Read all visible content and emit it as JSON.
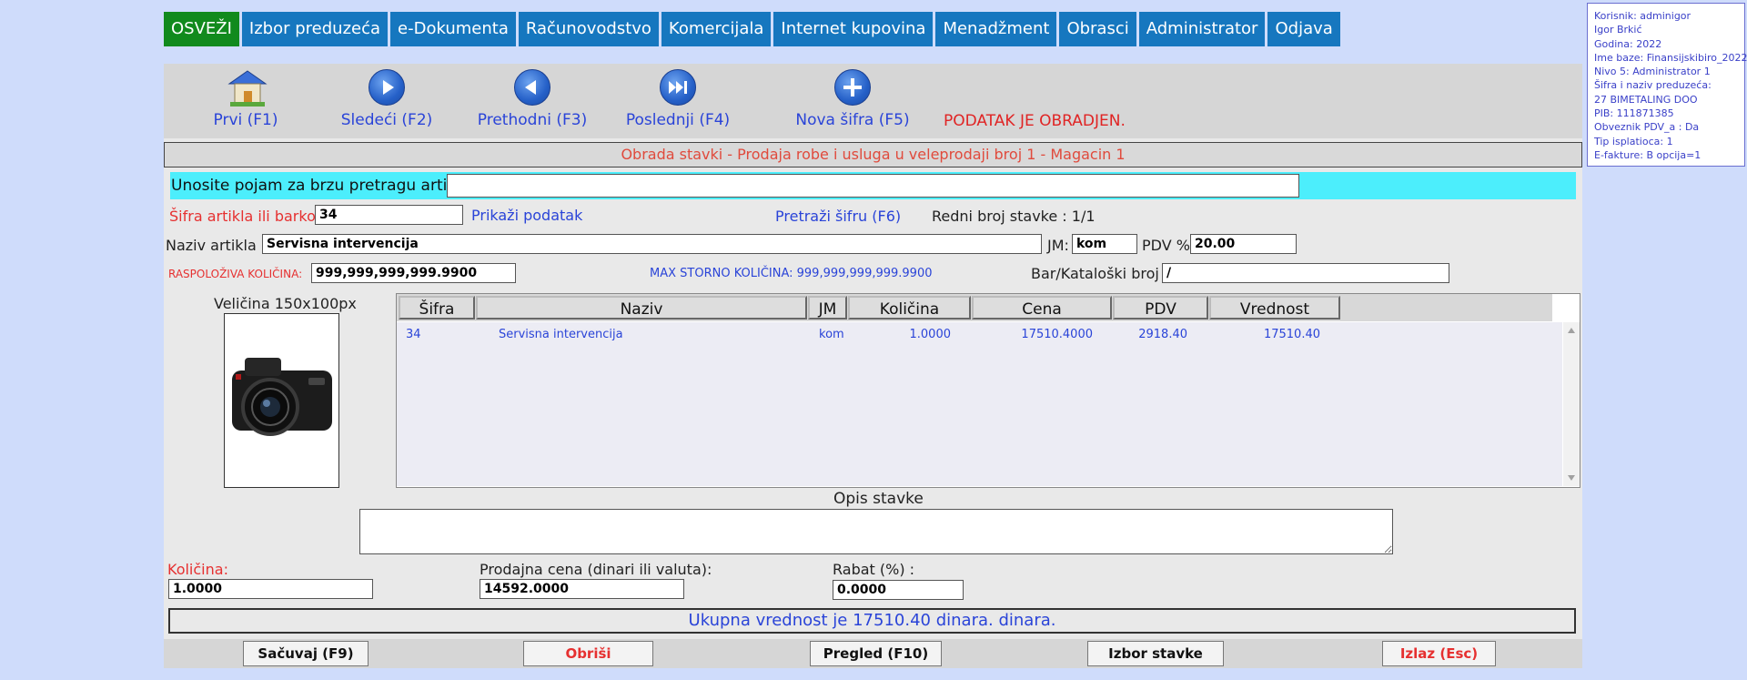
{
  "menu": [
    {
      "label": "OSVEŽI"
    },
    {
      "label": "Izbor preduzeća"
    },
    {
      "label": "e-Dokumenta"
    },
    {
      "label": "Računovodstvo"
    },
    {
      "label": "Komercijala"
    },
    {
      "label": "Internet kupovina"
    },
    {
      "label": "Menadžment"
    },
    {
      "label": "Obrasci"
    },
    {
      "label": "Administrator"
    },
    {
      "label": "Odjava"
    }
  ],
  "info": {
    "lines": [
      "Korisnik: adminigor",
      "Igor Brkić",
      "Godina: 2022",
      "Ime baze: Finansijskibiro_2022",
      "Nivo 5: Administrator 1",
      "Šifra i naziv preduzeća:",
      "27 BIMETALING DOO",
      "PIB: 111871385",
      "Obveznik PDV_a : Da",
      "Tip isplatioca: 1",
      "E-fakture: B opcija=1"
    ]
  },
  "toolbar": {
    "first": "Prvi (F1)",
    "next": "Sledeći (F2)",
    "prev": "Prethodni (F3)",
    "last": "Poslednji (F4)",
    "new_code": "Nova šifra (F5)",
    "status": "PODATAK JE OBRADJEN."
  },
  "title": "Obrada stavki - Prodaja robe i usluga u veleprodaji broj 1 - Magacin 1",
  "search": {
    "label": "Unosite pojam za brzu pretragu artikla :",
    "value": ""
  },
  "form": {
    "code_label": "Šifra artikla ili barkod :",
    "code_value": "34",
    "show_data": "Prikaži podatak",
    "search_code": "Pretraži šifru (F6)",
    "row_no": "Redni broj stavke : 1/1",
    "name_label": "Naziv artikla :",
    "name_value": "Servisna intervencija",
    "jm_label": "JM:",
    "jm_value": "kom",
    "pdv_label": "PDV %",
    "pdv_value": "20.00",
    "avail_label": "RASPOLOŽIVA KOLIČINA:",
    "avail_value": "999,999,999,999.9900",
    "max_storno": "MAX STORNO KOLIČINA: 999,999,999,999.9900",
    "barcat_label": "Bar/Kataloški broj :",
    "barcat_value": "/",
    "image_label": "Veličina 150x100px"
  },
  "table": {
    "headers": [
      "Šifra",
      "Naziv",
      "JM",
      "Količina",
      "Cena",
      "PDV",
      "Vrednost"
    ],
    "rows": [
      [
        "34",
        "Servisna intervencija",
        "kom",
        "1.0000",
        "17510.4000",
        "2918.40",
        "17510.40"
      ]
    ]
  },
  "opis": {
    "label": "Opis stavke",
    "value": ""
  },
  "bottom_fields": {
    "qty_label": "Količina:",
    "qty_value": "1.0000",
    "price_label": "Prodajna cena (dinari ili valuta):",
    "price_value": "14592.0000",
    "discount_label": "Rabat (%) :",
    "discount_value": "0.0000"
  },
  "total": "Ukupna vrednost je 17510.40 dinara. dinara.",
  "buttons": {
    "save": "Sačuvaj (F9)",
    "delete": "Obriši",
    "preview": "Pregled (F10)",
    "choose": "Izbor stavke",
    "exit": "Izlaz (Esc)"
  },
  "colors": {
    "menu_bg": "#1677bf",
    "menu_active": "#118a1d",
    "link_blue": "#2a44d8",
    "alert_red": "#e63030",
    "search_bg": "#4ceefc"
  }
}
